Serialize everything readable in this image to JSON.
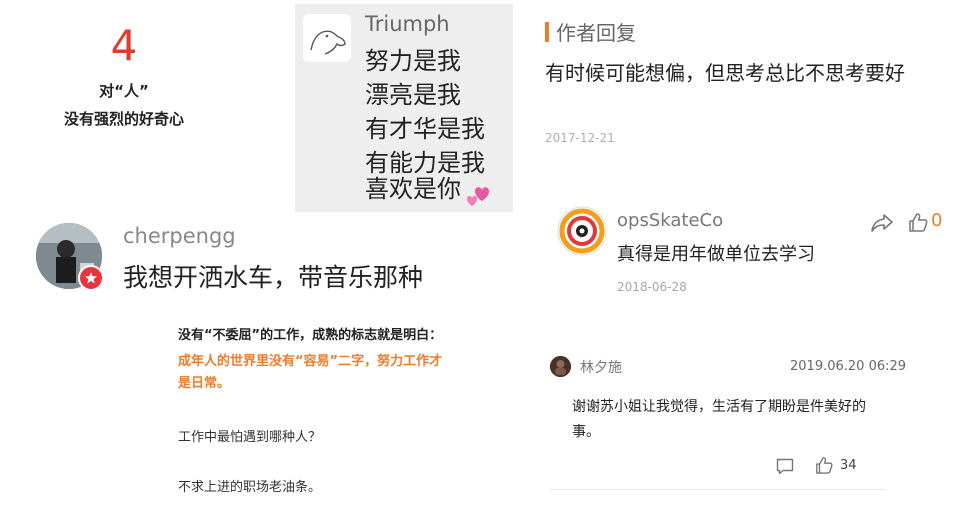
{
  "tile1": {
    "number": "4",
    "line1": "对“人”",
    "line2": "没有强烈的好奇心"
  },
  "tile2": {
    "name": "Triumph",
    "lines": [
      "努力是我",
      "漂亮是我",
      "有才华是我",
      "有能力是我",
      "喜欢是你"
    ],
    "heart_icon": "two-hearts-icon",
    "bg_color": "#eeeeee"
  },
  "tile3": {
    "title": "作者回复",
    "text": "有时候可能想偏，但思考总比不思考要好",
    "date": "2017-12-21",
    "accent": "#f07b2a"
  },
  "tile4": {
    "name": "cherpengg",
    "message": "我想开洒水车，带音乐那种",
    "badge_color": "#e8343a"
  },
  "tile5": {
    "name": "opsSkateCo",
    "message": "真得是用年做单位去学习",
    "date": "2018-06-28",
    "like_count": "0",
    "share_icon": "share-icon",
    "like_icon": "thumbs-up-icon"
  },
  "tile6": {
    "line1": "没有“不委屈”的工作，成熟的标志就是明白：",
    "line2": "成年人的世界里没有“容易”二字，努力工作才",
    "line3": "是日常。",
    "line4": "工作中最怕遇到哪种人？",
    "line5": "不求上进的职场老油条。"
  },
  "tile7": {
    "name": "林夕施",
    "time": "2019.06.20 06:29",
    "text": "谢谢苏小姐让我觉得，生活有了期盼是件美好的事。",
    "like_count": "34",
    "comment_icon": "comment-icon",
    "like_icon": "thumbs-up-icon"
  }
}
